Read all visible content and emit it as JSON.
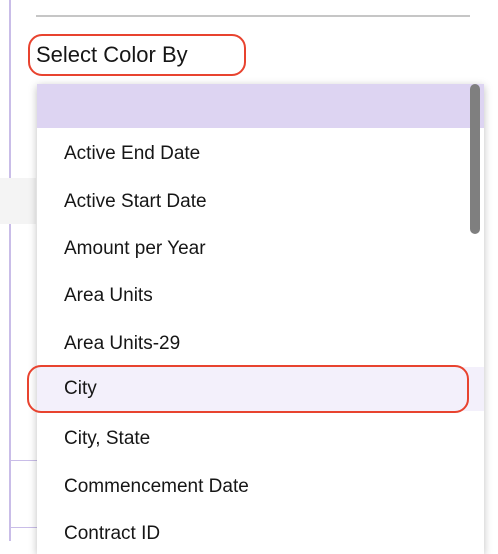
{
  "selector": {
    "label": "Select Color By"
  },
  "dropdown": {
    "options": [
      "",
      "Active End Date",
      "Active Start Date",
      "Amount per Year",
      "Area Units",
      "Area Units-29",
      "City",
      "City, State",
      "Commencement Date",
      "Contract ID"
    ],
    "highlighted_option": "City"
  },
  "colors": {
    "highlight_border": "#e8432f",
    "selected_row": "#ddd4f2",
    "hover_row": "#f3f0fb",
    "accent_edge": "#c9bde8"
  }
}
